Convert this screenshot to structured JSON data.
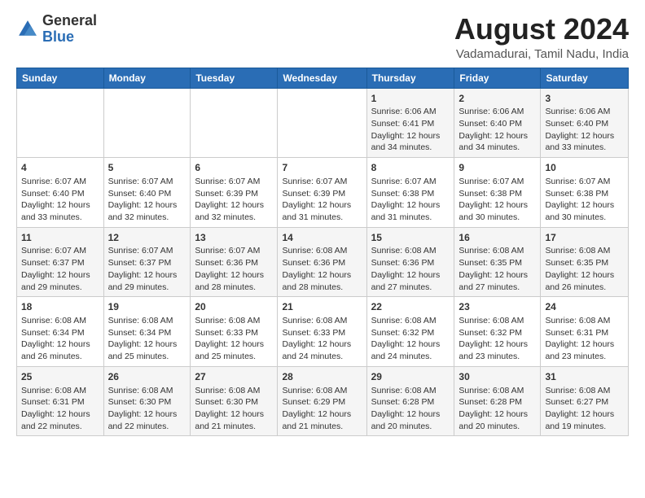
{
  "logo": {
    "general": "General",
    "blue": "Blue"
  },
  "header": {
    "title": "August 2024",
    "subtitle": "Vadamadurai, Tamil Nadu, India"
  },
  "weekdays": [
    "Sunday",
    "Monday",
    "Tuesday",
    "Wednesday",
    "Thursday",
    "Friday",
    "Saturday"
  ],
  "weeks": [
    [
      {
        "day": "",
        "info": ""
      },
      {
        "day": "",
        "info": ""
      },
      {
        "day": "",
        "info": ""
      },
      {
        "day": "",
        "info": ""
      },
      {
        "day": "1",
        "info": "Sunrise: 6:06 AM\nSunset: 6:41 PM\nDaylight: 12 hours\nand 34 minutes."
      },
      {
        "day": "2",
        "info": "Sunrise: 6:06 AM\nSunset: 6:40 PM\nDaylight: 12 hours\nand 34 minutes."
      },
      {
        "day": "3",
        "info": "Sunrise: 6:06 AM\nSunset: 6:40 PM\nDaylight: 12 hours\nand 33 minutes."
      }
    ],
    [
      {
        "day": "4",
        "info": "Sunrise: 6:07 AM\nSunset: 6:40 PM\nDaylight: 12 hours\nand 33 minutes."
      },
      {
        "day": "5",
        "info": "Sunrise: 6:07 AM\nSunset: 6:40 PM\nDaylight: 12 hours\nand 32 minutes."
      },
      {
        "day": "6",
        "info": "Sunrise: 6:07 AM\nSunset: 6:39 PM\nDaylight: 12 hours\nand 32 minutes."
      },
      {
        "day": "7",
        "info": "Sunrise: 6:07 AM\nSunset: 6:39 PM\nDaylight: 12 hours\nand 31 minutes."
      },
      {
        "day": "8",
        "info": "Sunrise: 6:07 AM\nSunset: 6:38 PM\nDaylight: 12 hours\nand 31 minutes."
      },
      {
        "day": "9",
        "info": "Sunrise: 6:07 AM\nSunset: 6:38 PM\nDaylight: 12 hours\nand 30 minutes."
      },
      {
        "day": "10",
        "info": "Sunrise: 6:07 AM\nSunset: 6:38 PM\nDaylight: 12 hours\nand 30 minutes."
      }
    ],
    [
      {
        "day": "11",
        "info": "Sunrise: 6:07 AM\nSunset: 6:37 PM\nDaylight: 12 hours\nand 29 minutes."
      },
      {
        "day": "12",
        "info": "Sunrise: 6:07 AM\nSunset: 6:37 PM\nDaylight: 12 hours\nand 29 minutes."
      },
      {
        "day": "13",
        "info": "Sunrise: 6:07 AM\nSunset: 6:36 PM\nDaylight: 12 hours\nand 28 minutes."
      },
      {
        "day": "14",
        "info": "Sunrise: 6:08 AM\nSunset: 6:36 PM\nDaylight: 12 hours\nand 28 minutes."
      },
      {
        "day": "15",
        "info": "Sunrise: 6:08 AM\nSunset: 6:36 PM\nDaylight: 12 hours\nand 27 minutes."
      },
      {
        "day": "16",
        "info": "Sunrise: 6:08 AM\nSunset: 6:35 PM\nDaylight: 12 hours\nand 27 minutes."
      },
      {
        "day": "17",
        "info": "Sunrise: 6:08 AM\nSunset: 6:35 PM\nDaylight: 12 hours\nand 26 minutes."
      }
    ],
    [
      {
        "day": "18",
        "info": "Sunrise: 6:08 AM\nSunset: 6:34 PM\nDaylight: 12 hours\nand 26 minutes."
      },
      {
        "day": "19",
        "info": "Sunrise: 6:08 AM\nSunset: 6:34 PM\nDaylight: 12 hours\nand 25 minutes."
      },
      {
        "day": "20",
        "info": "Sunrise: 6:08 AM\nSunset: 6:33 PM\nDaylight: 12 hours\nand 25 minutes."
      },
      {
        "day": "21",
        "info": "Sunrise: 6:08 AM\nSunset: 6:33 PM\nDaylight: 12 hours\nand 24 minutes."
      },
      {
        "day": "22",
        "info": "Sunrise: 6:08 AM\nSunset: 6:32 PM\nDaylight: 12 hours\nand 24 minutes."
      },
      {
        "day": "23",
        "info": "Sunrise: 6:08 AM\nSunset: 6:32 PM\nDaylight: 12 hours\nand 23 minutes."
      },
      {
        "day": "24",
        "info": "Sunrise: 6:08 AM\nSunset: 6:31 PM\nDaylight: 12 hours\nand 23 minutes."
      }
    ],
    [
      {
        "day": "25",
        "info": "Sunrise: 6:08 AM\nSunset: 6:31 PM\nDaylight: 12 hours\nand 22 minutes."
      },
      {
        "day": "26",
        "info": "Sunrise: 6:08 AM\nSunset: 6:30 PM\nDaylight: 12 hours\nand 22 minutes."
      },
      {
        "day": "27",
        "info": "Sunrise: 6:08 AM\nSunset: 6:30 PM\nDaylight: 12 hours\nand 21 minutes."
      },
      {
        "day": "28",
        "info": "Sunrise: 6:08 AM\nSunset: 6:29 PM\nDaylight: 12 hours\nand 21 minutes."
      },
      {
        "day": "29",
        "info": "Sunrise: 6:08 AM\nSunset: 6:28 PM\nDaylight: 12 hours\nand 20 minutes."
      },
      {
        "day": "30",
        "info": "Sunrise: 6:08 AM\nSunset: 6:28 PM\nDaylight: 12 hours\nand 20 minutes."
      },
      {
        "day": "31",
        "info": "Sunrise: 6:08 AM\nSunset: 6:27 PM\nDaylight: 12 hours\nand 19 minutes."
      }
    ]
  ]
}
